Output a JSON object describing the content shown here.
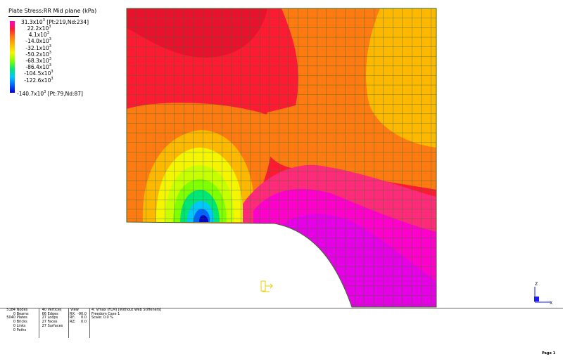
{
  "legend": {
    "title": "Plate Stress:RR Mid plane  (kPa)",
    "max_label": "31.3x10",
    "max_exp": "3",
    "max_location": "[Pt:219,Nd:234]",
    "min_label": "-140.7x10",
    "min_exp": "3",
    "min_location": "[Pt:79,Nd:87]",
    "levels": [
      {
        "value": "22.2x10",
        "exp": "3",
        "color": "#ff00cc"
      },
      {
        "value": "4.1x10",
        "exp": "3",
        "color": "#ff1a33"
      },
      {
        "value": "-14.0x10",
        "exp": "3",
        "color": "#ff7a10"
      },
      {
        "value": "-32.1x10",
        "exp": "3",
        "color": "#ffb800"
      },
      {
        "value": "-50.2x10",
        "exp": "3",
        "color": "#f5f500"
      },
      {
        "value": "-68.3x10",
        "exp": "3",
        "color": "#80ff00"
      },
      {
        "value": "-86.4x10",
        "exp": "3",
        "color": "#00e676"
      },
      {
        "value": "-104.5x10",
        "exp": "3",
        "color": "#00c8ff"
      },
      {
        "value": "-122.6x10",
        "exp": "3",
        "color": "#0066ff"
      },
      {
        "value": "",
        "exp": "",
        "color": "#0000cc"
      }
    ]
  },
  "stats": {
    "counts": [
      {
        "value": "5184",
        "label": "Nodes"
      },
      {
        "value": "0",
        "label": "Beams"
      },
      {
        "value": "5040",
        "label": "Plates"
      },
      {
        "value": "0",
        "label": "Bricks"
      },
      {
        "value": "0",
        "label": "Links"
      },
      {
        "value": "0",
        "label": "Paths"
      }
    ],
    "geometry": [
      {
        "value": "40",
        "label": "Vertices"
      },
      {
        "value": "66",
        "label": "Edges"
      },
      {
        "value": "27",
        "label": "Loops"
      },
      {
        "value": "27",
        "label": "Faces"
      },
      {
        "value": "27",
        "label": "Surfaces"
      }
    ],
    "view": {
      "heading": "View",
      "rows": [
        {
          "label": "RX:",
          "value": "-90.0"
        },
        {
          "label": "RY:",
          "value": "0.0"
        },
        {
          "label": "RZ:",
          "value": "0.0"
        }
      ]
    },
    "model": {
      "title": "4: Vmax (FLM) [Without Web Stiffeners]",
      "case": "Freedom Case 1",
      "scale": "Scale: 0.0 %"
    }
  },
  "axes": {
    "z": "Z",
    "x": "X",
    "color": "#1a1aff"
  },
  "page": "Page 1"
}
